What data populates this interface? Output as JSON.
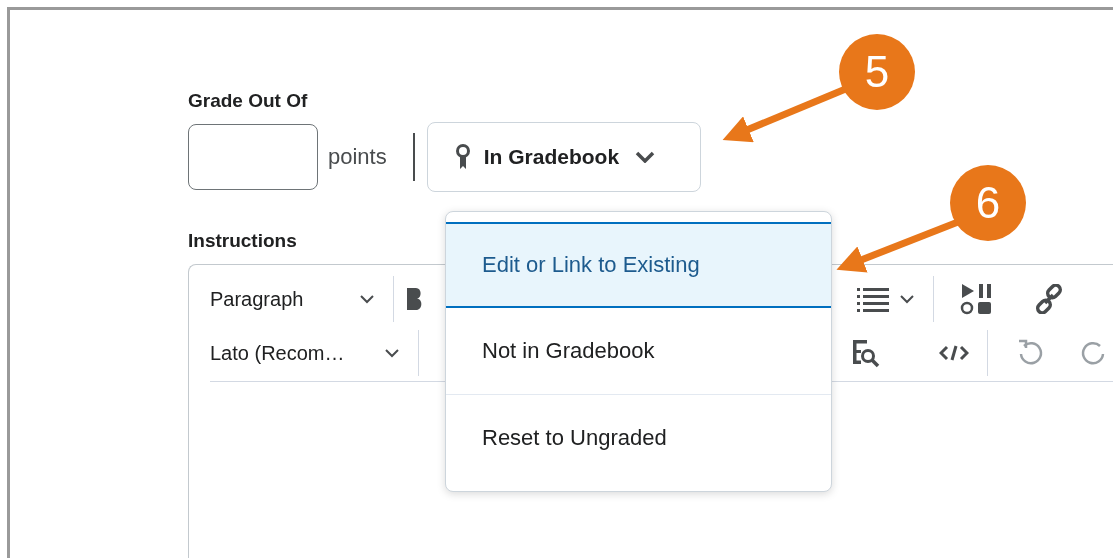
{
  "grade": {
    "label": "Grade Out Of",
    "unit": "points",
    "gradebook_button": "In Gradebook"
  },
  "gradebook_menu": [
    {
      "label": "Edit or Link to Existing",
      "selected": true
    },
    {
      "label": "Not in Gradebook",
      "selected": false
    },
    {
      "label": "Reset to Ungraded",
      "selected": false
    }
  ],
  "instructions": {
    "label": "Instructions",
    "block_format": "Paragraph",
    "font": "Lato (Recom…"
  },
  "callouts": [
    {
      "number": "5"
    },
    {
      "number": "6"
    }
  ]
}
